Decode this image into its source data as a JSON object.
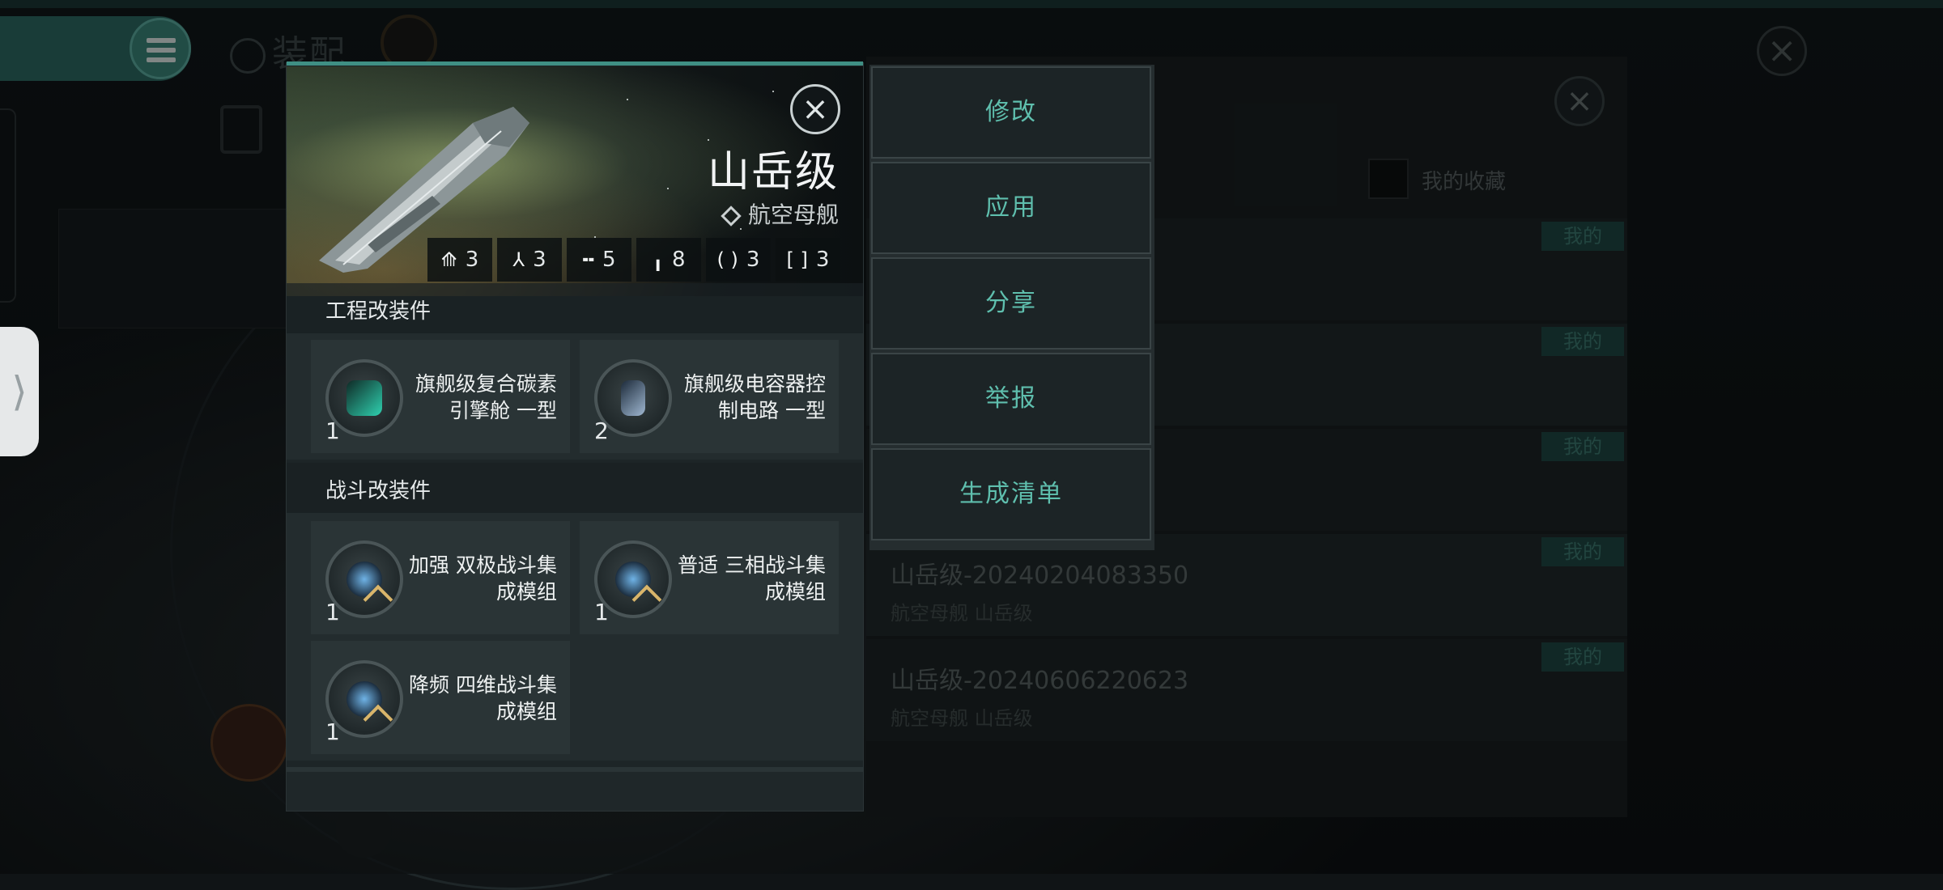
{
  "app": {
    "page_title": "装配"
  },
  "ship": {
    "name": "山岳级",
    "class": "航空母舰",
    "slots": [
      {
        "icon": "high-slot-icon",
        "value": "3"
      },
      {
        "icon": "mid-slot-icon",
        "value": "3"
      },
      {
        "icon": "low-slot-icon",
        "value": "5"
      },
      {
        "icon": "rig-slot-icon",
        "value": "8"
      },
      {
        "icon": "drone-slot-icon",
        "value": "3"
      },
      {
        "icon": "misc-slot-icon",
        "value": "3"
      }
    ]
  },
  "engineering": {
    "title": "工程改装件",
    "modules": [
      {
        "name": "旗舰级复合碳素引擎舱 一型",
        "count": "1",
        "color": "#2fd1b0"
      },
      {
        "name": "旗舰级电容器控制电路 一型",
        "count": "2",
        "color": "#5a7fa8"
      }
    ]
  },
  "combat": {
    "title": "战斗改装件",
    "modules": [
      {
        "name": "加强 双极战斗集成模组",
        "count": "1",
        "color": "#4b86b8"
      },
      {
        "name": "普适 三相战斗集成模组",
        "count": "1",
        "color": "#4b86b8"
      },
      {
        "name": "降频 四维战斗集成模组",
        "count": "1",
        "color": "#4b86b8"
      }
    ]
  },
  "actions": [
    "修改",
    "应用",
    "分享",
    "举报",
    "生成清单"
  ],
  "blueprints": {
    "favorites_label": "我的收藏",
    "mine_label": "我的",
    "rows": [
      {
        "name": "山岳级-20240204083350",
        "sub": "航空母舰 山岳级"
      },
      {
        "name": "山岳级-20240606220623",
        "sub": "航空母舰 山岳级"
      }
    ]
  },
  "colors": {
    "accent": "#3f8f84",
    "action_text": "#5fbfae",
    "badge_bg": "#1f4a45"
  }
}
